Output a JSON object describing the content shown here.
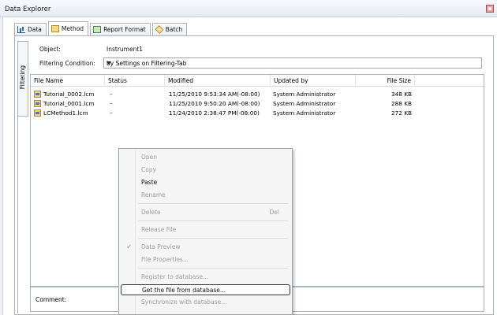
{
  "window": {
    "title": "Data Explorer"
  },
  "tabs": [
    {
      "label": "Data",
      "icon": "chart-icon"
    },
    {
      "label": "Method",
      "icon": "method-icon"
    },
    {
      "label": "Report Format",
      "icon": "report-icon"
    },
    {
      "label": "Batch",
      "icon": "batch-icon"
    }
  ],
  "side_tab": {
    "label": "Filtering"
  },
  "object": {
    "label": "Object:",
    "value": "Instrument1"
  },
  "filter": {
    "label": "Filtering Condition:",
    "value": "by Settings on Filtering-Tab"
  },
  "columns": [
    "File Name",
    "Status",
    "Modified",
    "Updated by",
    "File Size"
  ],
  "rows": [
    {
      "name": "Tutorial_0002.lcm",
      "status": "–",
      "modified": "11/25/2010 9:53:34 AM(-08:00)",
      "updated_by": "System Administrator",
      "size": "348 KB"
    },
    {
      "name": "Tutorial_0001.lcm",
      "status": "–",
      "modified": "11/25/2010 9:50:20 AM(-08:00)",
      "updated_by": "System Administrator",
      "size": "288 KB"
    },
    {
      "name": "LCMethod1.lcm",
      "status": "–",
      "modified": "11/24/2010 2:38:47 PM(-08:00)",
      "updated_by": "System Administrator",
      "size": "272 KB"
    }
  ],
  "comment": {
    "label": "Comment:"
  },
  "context_menu": {
    "open": "Open",
    "copy": "Copy",
    "paste": "Paste",
    "rename": "Rename",
    "delete": "Delete",
    "delete_shortcut": "Del",
    "release_file": "Release File",
    "data_preview": "Data Preview",
    "file_properties": "File Properties...",
    "register": "Register to database...",
    "get_file": "Get the file from database...",
    "synchronize": "Synchronize with database..."
  },
  "colors": {
    "accent": "#2b5fb3",
    "border": "#a9b3c2"
  }
}
